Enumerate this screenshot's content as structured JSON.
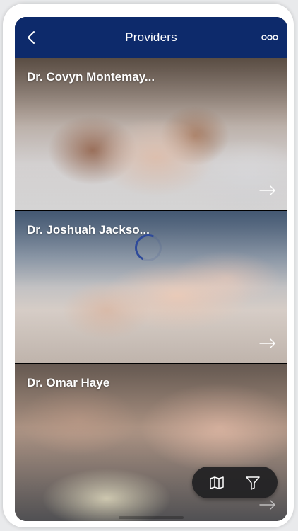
{
  "header": {
    "title": "Providers",
    "back_icon": "chevron-left-icon",
    "more_icon": "more-dots-icon"
  },
  "providers": [
    {
      "name": "Dr. Covyn Montemay..."
    },
    {
      "name": "Dr. Joshuah Jackso..."
    },
    {
      "name": "Dr. Omar Haye"
    }
  ],
  "floating_bar": {
    "map_icon": "map-icon",
    "filter_icon": "filter-icon"
  },
  "colors": {
    "header_bg": "#0d2a6b",
    "text_on_header": "#ffffff",
    "spinner": "#2e4a9a"
  }
}
